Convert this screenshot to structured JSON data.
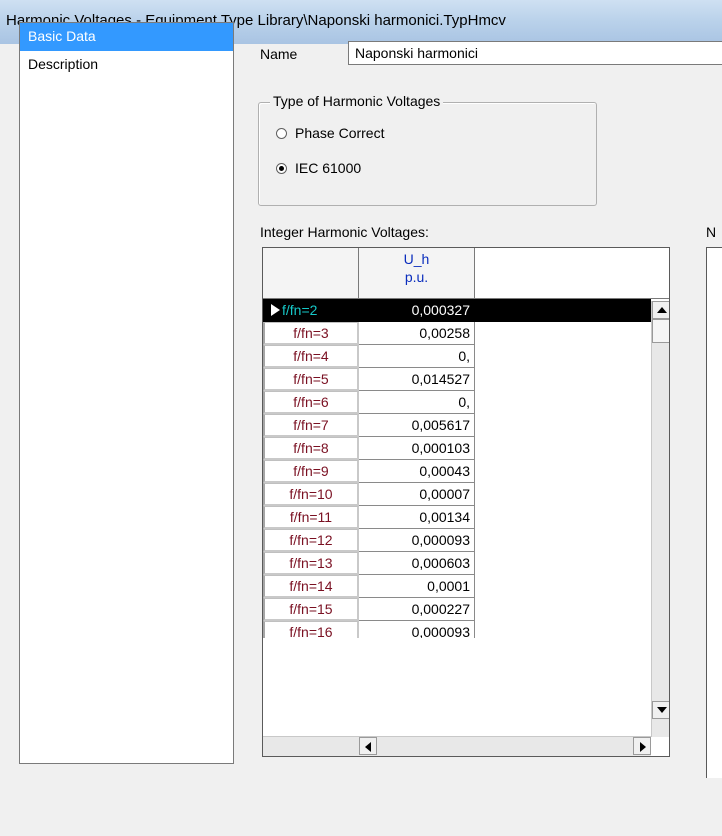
{
  "window": {
    "title": "Harmonic Voltages - Equipment Type Library\\Naponski harmonici.TypHmcv"
  },
  "nav": {
    "items": [
      {
        "label": "Basic Data",
        "selected": true
      },
      {
        "label": "Description",
        "selected": false
      }
    ]
  },
  "form": {
    "name_label": "Name",
    "name_value": "Naponski harmonici",
    "type_group_title": "Type of Harmonic Voltages",
    "options": [
      {
        "label": "Phase Correct",
        "selected": false
      },
      {
        "label": "IEC 61000",
        "selected": true
      }
    ]
  },
  "grid": {
    "label": "Integer Harmonic Voltages:",
    "right_label_fragment": "N",
    "column_header_line1": "U_h",
    "column_header_line2": "p.u.",
    "rows": [
      {
        "order": "f/fn=2",
        "value": "0,000327"
      },
      {
        "order": "f/fn=3",
        "value": "0,00258"
      },
      {
        "order": "f/fn=4",
        "value": "0,"
      },
      {
        "order": "f/fn=5",
        "value": "0,014527"
      },
      {
        "order": "f/fn=6",
        "value": "0,"
      },
      {
        "order": "f/fn=7",
        "value": "0,005617"
      },
      {
        "order": "f/fn=8",
        "value": "0,000103"
      },
      {
        "order": "f/fn=9",
        "value": "0,00043"
      },
      {
        "order": "f/fn=10",
        "value": "0,00007"
      },
      {
        "order": "f/fn=11",
        "value": "0,00134"
      },
      {
        "order": "f/fn=12",
        "value": "0,000093"
      },
      {
        "order": "f/fn=13",
        "value": "0,000603"
      },
      {
        "order": "f/fn=14",
        "value": "0,0001"
      },
      {
        "order": "f/fn=15",
        "value": "0,000227"
      },
      {
        "order": "f/fn=16",
        "value": "0,000093"
      }
    ]
  }
}
